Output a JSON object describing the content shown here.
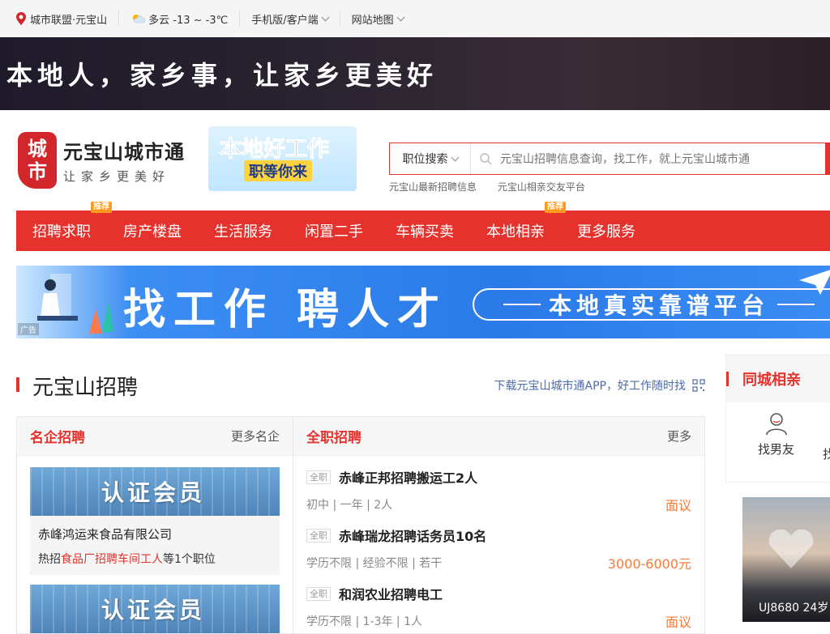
{
  "topbar": {
    "city": "城市联盟·元宝山",
    "weather": "多云 -13 ~ -3℃",
    "mobile": "手机版/客户端",
    "sitemap": "网站地图"
  },
  "banner": {
    "slogan": "本地人，家乡事，让家乡更美好"
  },
  "logo": {
    "seal_top": "城",
    "seal_bottom": "市",
    "title": "元宝山城市通",
    "subtitle": "让家乡更美好"
  },
  "job_badge": {
    "line1": "本地好工作",
    "line2": "职等你来"
  },
  "search": {
    "category": "职位搜索",
    "placeholder": "元宝山招聘信息查询，找工作，就上元宝山城市通"
  },
  "hotlinks": [
    "元宝山最新招聘信息",
    "元宝山相亲交友平台"
  ],
  "nav": [
    {
      "label": "招聘求职",
      "tag": "推荐"
    },
    {
      "label": "房产楼盘",
      "tag": ""
    },
    {
      "label": "生活服务",
      "tag": ""
    },
    {
      "label": "闲置二手",
      "tag": ""
    },
    {
      "label": "车辆买卖",
      "tag": ""
    },
    {
      "label": "本地相亲",
      "tag": "推荐"
    },
    {
      "label": "更多服务",
      "tag": ""
    }
  ],
  "ad": {
    "headline": "找工作 聘人才",
    "pill": "本地真实靠谱平台",
    "tag": "广告"
  },
  "section": {
    "title": "元宝山招聘",
    "download": "下载元宝山城市通APP，好工作随时找"
  },
  "famous": {
    "title": "名企招聘",
    "more": "更多名企",
    "banner_text": "认证会员",
    "companies": [
      {
        "name": "赤峰鸿运来食品有限公司",
        "desc_pre": "热招",
        "desc_hl": "食品厂招聘车间工人",
        "desc_post": "等1个职位"
      }
    ],
    "second_banner_text": "认证会员"
  },
  "fulltime": {
    "title": "全职招聘",
    "more": "更多",
    "jobs": [
      {
        "tag": "全职",
        "title": "赤峰正邦招聘搬运工2人",
        "meta": "初中 | 一年 | 2人",
        "salary": "面议"
      },
      {
        "tag": "全职",
        "title": "赤峰瑞龙招聘话务员10名",
        "meta": "学历不限 | 经验不限 | 若干",
        "salary": "3000-6000元"
      },
      {
        "tag": "全职",
        "title": "和润农业招聘电工",
        "meta": "学历不限 | 1-3年 | 1人",
        "salary": "面议"
      }
    ]
  },
  "side": {
    "title": "同城相亲",
    "item1": "找男友",
    "item2_partial": "找",
    "photo_caption": "UJ8680 24岁"
  }
}
